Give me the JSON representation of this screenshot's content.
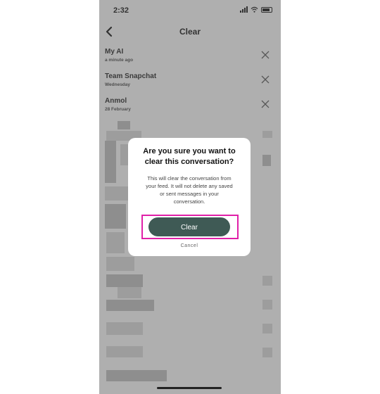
{
  "status_bar": {
    "time": "2:32"
  },
  "header": {
    "title": "Clear"
  },
  "conversations": [
    {
      "name": "My AI",
      "time": "a minute ago"
    },
    {
      "name": "Team Snapchat",
      "time": "Wednesday"
    },
    {
      "name": "Anmol",
      "time": "28 February"
    }
  ],
  "dialog": {
    "title_line1": "Are you sure you want to",
    "title_line2": "clear this conversation?",
    "message_line1": "This will clear the conversation from",
    "message_line2": "your feed. It will not delete any saved",
    "message_line3": "or sent messages in your",
    "message_line4": "conversation.",
    "clear_label": "Clear",
    "cancel_label": "Cancel"
  },
  "colors": {
    "clear_button": "#3f5a55",
    "highlight": "#e020a8"
  },
  "icons": [
    "back-chevron-icon",
    "close-icon",
    "signal-icon",
    "wifi-icon",
    "battery-icon"
  ]
}
